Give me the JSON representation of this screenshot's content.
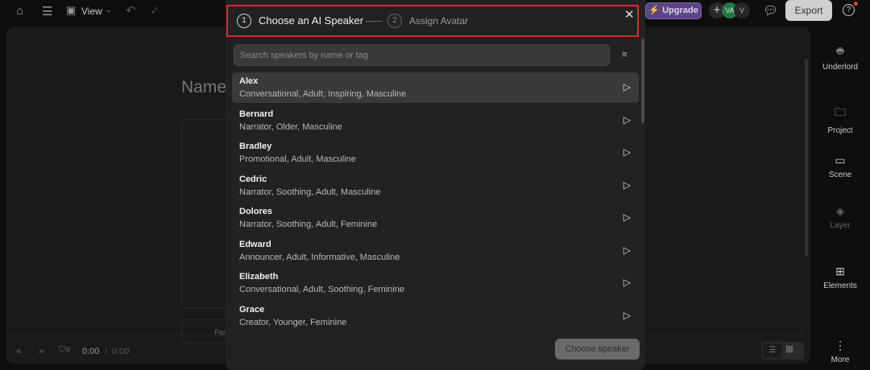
{
  "topbar": {
    "view_label": "View",
    "upgrade_label": "Upgrade",
    "avatar_initials": "VA",
    "avatar_v": "V",
    "export_label": "Export"
  },
  "editor": {
    "name_placeholder": "Name",
    "paste_placeholder": "Pas",
    "time_current": "0:00",
    "time_sep": "/",
    "time_total": "0:00"
  },
  "sidebar": {
    "items": [
      {
        "label": "Underlord"
      },
      {
        "label": "Project"
      },
      {
        "label": "Scene"
      },
      {
        "label": "Layer"
      },
      {
        "label": "Elements"
      },
      {
        "label": "More"
      }
    ]
  },
  "modal": {
    "step1_num": "1",
    "step1_label": "Choose an AI Speaker",
    "step2_num": "2",
    "step2_label": "Assign Avatar",
    "search_placeholder": "Search speakers by name or tag",
    "speakers": [
      {
        "name": "Alex",
        "tags": "Conversational, Adult, Inspiring, Masculine"
      },
      {
        "name": "Bernard",
        "tags": "Narrator, Older, Masculine"
      },
      {
        "name": "Bradley",
        "tags": "Promotional, Adult, Masculine"
      },
      {
        "name": "Cedric",
        "tags": "Narrator, Soothing, Adult, Masculine"
      },
      {
        "name": "Dolores",
        "tags": "Narrator, Soothing, Adult, Feminine"
      },
      {
        "name": "Edward",
        "tags": "Announcer, Adult, Informative, Masculine"
      },
      {
        "name": "Elizabeth",
        "tags": "Conversational, Adult, Soothing, Feminine"
      },
      {
        "name": "Grace",
        "tags": "Creator, Younger, Feminine"
      }
    ],
    "choose_button": "Choose speaker"
  },
  "colors": {
    "accent_red": "#d9282f",
    "upgrade": "#5b4585",
    "avatar_green": "#1f7a47"
  }
}
